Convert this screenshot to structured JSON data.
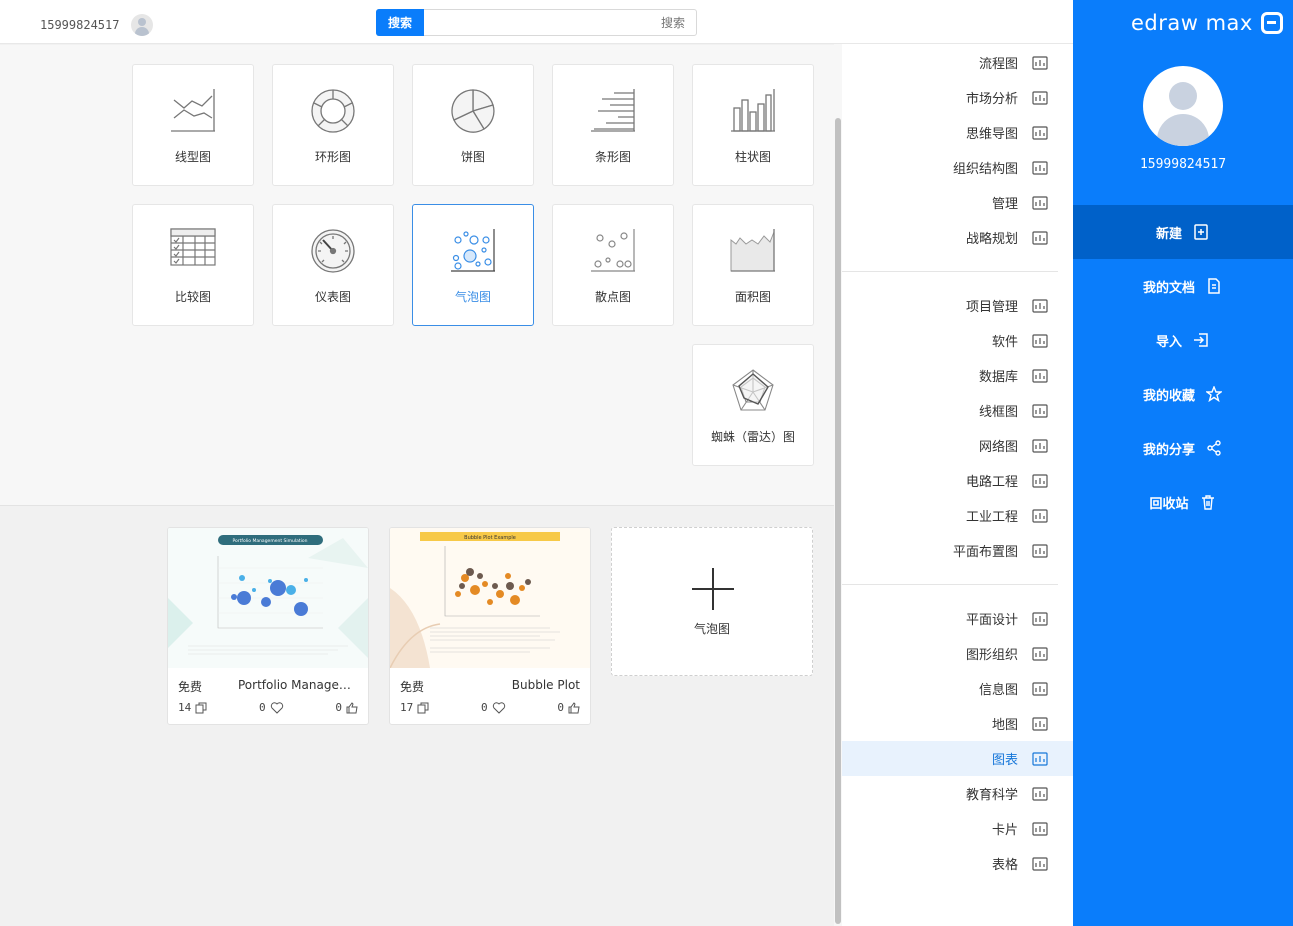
{
  "app": {
    "logo_text": "edraw max"
  },
  "user": {
    "id": "15999824517"
  },
  "search": {
    "button": "搜索",
    "placeholder": "搜索"
  },
  "sidebar": {
    "items": [
      {
        "label": "新建",
        "icon": "add-file-icon",
        "active": true
      },
      {
        "label": "我的文档",
        "icon": "document-icon",
        "active": false
      },
      {
        "label": "导入",
        "icon": "import-icon",
        "active": false
      },
      {
        "label": "我的收藏",
        "icon": "star-icon",
        "active": false
      },
      {
        "label": "我的分享",
        "icon": "share-icon",
        "active": false
      },
      {
        "label": "回收站",
        "icon": "trash-icon",
        "active": false
      }
    ]
  },
  "categories": {
    "group1": [
      "流程图",
      "市场分析",
      "思维导图",
      "组织结构图",
      "管理",
      "战略规划"
    ],
    "group2": [
      "项目管理",
      "软件",
      "数据库",
      "线框图",
      "网络图",
      "电路工程",
      "工业工程",
      "平面布置图"
    ],
    "group3": [
      "平面设计",
      "图形组织",
      "信息图",
      "地图",
      "图表",
      "教育科学",
      "卡片",
      "表格"
    ],
    "active": "图表"
  },
  "chart_types": {
    "row1": [
      "柱状图",
      "条形图",
      "饼图",
      "环形图",
      "线型图"
    ],
    "row2": [
      "面积图",
      "散点图",
      "气泡图",
      "仪表图",
      "比较图"
    ],
    "row3": [
      "蜘蛛（雷达）图"
    ],
    "selected": "气泡图"
  },
  "templates": {
    "add_label": "气泡图",
    "items": [
      {
        "name": "Bubble Plot",
        "price": "免费",
        "likes": "0",
        "favorites": "0",
        "copies": "17",
        "thumb_title": "Bubble Plot Example"
      },
      {
        "name": "Portfolio Managemen...",
        "price": "免费",
        "likes": "0",
        "favorites": "0",
        "copies": "14",
        "thumb_title": "Portfolio Management Simulation"
      }
    ]
  },
  "colors": {
    "brand": "#0a7dfb",
    "active_nav": "#0061c9",
    "selection": "#3a8ee6"
  }
}
